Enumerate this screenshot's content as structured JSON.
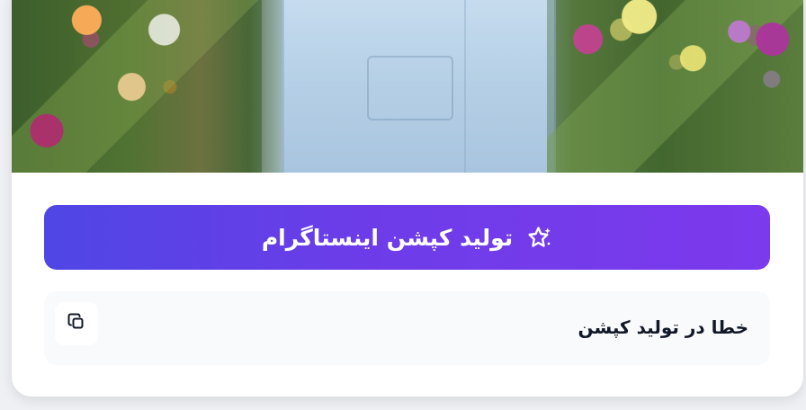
{
  "image": {
    "alt": "person in light blue shirt among plants and orchids"
  },
  "actions": {
    "generate_caption_label": "تولید کپشن اینستاگرام"
  },
  "result": {
    "error_text": "خطا در تولید کپشن"
  },
  "icons": {
    "generate": "sparkles-icon",
    "copy": "copy-icon"
  },
  "colors": {
    "button_start": "#4f46e5",
    "button_end": "#7c3aed",
    "result_background": "#f8fafc",
    "text": "#111827"
  }
}
